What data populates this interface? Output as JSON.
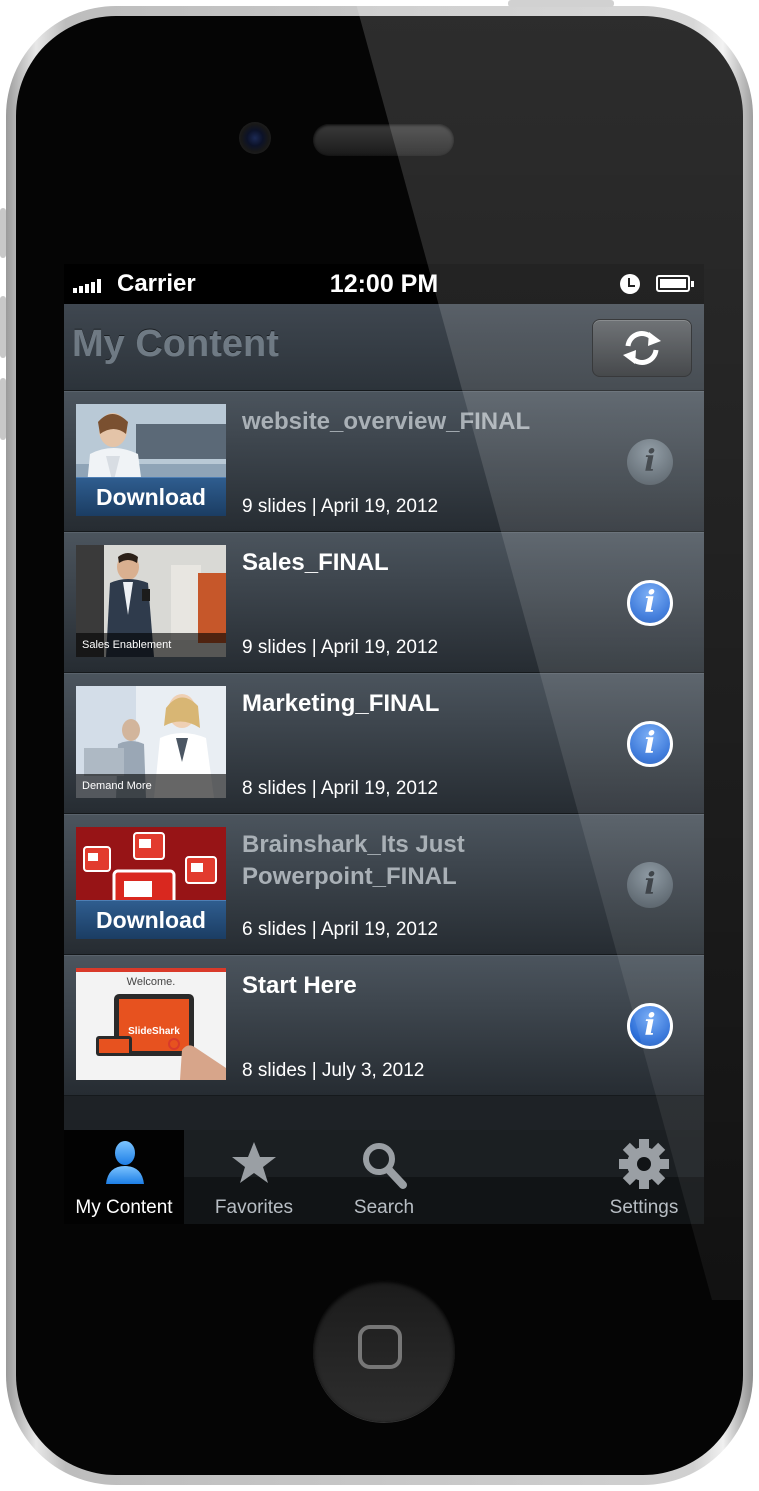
{
  "status_bar": {
    "carrier": "Carrier",
    "time": "12:00 PM",
    "icons": [
      "signal-icon",
      "alarm-icon",
      "battery-icon"
    ]
  },
  "nav": {
    "title": "My Content",
    "refresh_icon": "refresh-icon"
  },
  "items": [
    {
      "title": "website_overview_FINAL",
      "meta": "9 slides | April 19, 2012",
      "thumb_label": "Download",
      "downloaded": false
    },
    {
      "title": "Sales_FINAL",
      "meta": "9 slides | April 19, 2012",
      "thumb_label": "Sales Enablement",
      "downloaded": true
    },
    {
      "title": "Marketing_FINAL",
      "meta": "8 slides | April 19, 2012",
      "thumb_label": "Demand More",
      "downloaded": true
    },
    {
      "title": "Brainshark_Its Just Powerpoint_FINAL",
      "meta": "6 slides | April 19, 2012",
      "thumb_label": "Download",
      "downloaded": false
    },
    {
      "title": "Start Here",
      "meta": "8 slides | July 3, 2012",
      "thumb_text_1": "Welcome.",
      "thumb_text_2": "SlideShark",
      "downloaded": true
    }
  ],
  "tabs": [
    {
      "label": "My Content",
      "icon": "person-icon",
      "active": true
    },
    {
      "label": "Favorites",
      "icon": "star-icon",
      "active": false
    },
    {
      "label": "Search",
      "icon": "search-icon",
      "active": false
    },
    {
      "label": "Settings",
      "icon": "gear-icon",
      "active": false
    }
  ],
  "info_glyph": "i",
  "colors": {
    "accent_blue": "#2d6fd8",
    "download_blue": "#1b3d63",
    "row_top": "#4b545d",
    "row_bottom": "#262c32",
    "title_dim": "#a9b0b6"
  }
}
